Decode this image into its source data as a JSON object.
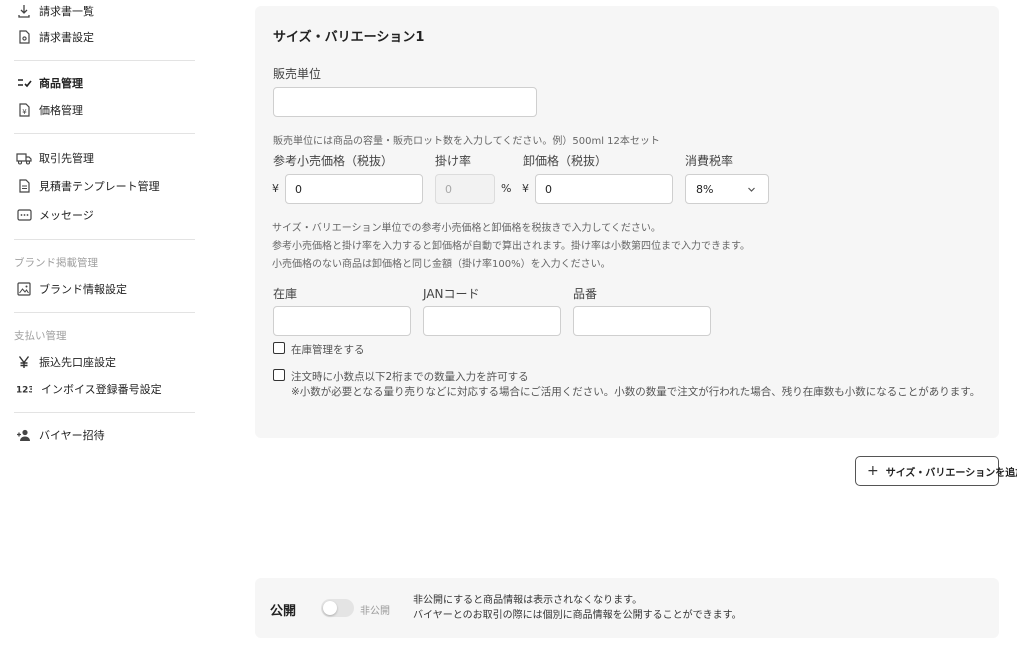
{
  "sidebar": {
    "items": [
      {
        "label": "請求書一覧",
        "icon": "download-icon"
      },
      {
        "label": "請求書設定",
        "icon": "document-gear-icon"
      },
      {
        "label": "商品管理",
        "icon": "list-check-icon"
      },
      {
        "label": "価格管理",
        "icon": "price-document-icon"
      },
      {
        "label": "取引先管理",
        "icon": "truck-icon"
      },
      {
        "label": "見積書テンプレート管理",
        "icon": "document-icon"
      },
      {
        "label": "メッセージ",
        "icon": "message-icon"
      },
      {
        "label": "ブランド情報設定",
        "icon": "image-icon"
      },
      {
        "label": "振込先口座設定",
        "icon": "yen-icon"
      },
      {
        "label": "インボイス登録番号設定",
        "icon": "number-icon"
      },
      {
        "label": "バイヤー招待",
        "icon": "person-add-icon"
      }
    ],
    "sections": {
      "brand": "ブランド掲載管理",
      "payment": "支払い管理"
    }
  },
  "variation": {
    "title": "サイズ・バリエーション1",
    "sales_unit_label": "販売単位",
    "sales_unit_value": "",
    "sales_unit_help": "販売単位には商品の容量・販売ロット数を入力してください。例）500ml 12本セット",
    "retail_price_label": "参考小売価格（税抜）",
    "rate_label": "掛け率",
    "wholesale_label": "卸価格（税抜）",
    "tax_label": "消費税率",
    "yen": "¥",
    "percent": "%",
    "retail_price_value": "0",
    "rate_value": "0",
    "wholesale_value": "0",
    "tax_value": "8%",
    "price_help_1": "サイズ・バリエーション単位での参考小売価格と卸価格を税抜きで入力してください。",
    "price_help_2": "参考小売価格と掛け率を入力すると卸価格が自動で算出されます。掛け率は小数第四位まで入力できます。",
    "price_help_3": "小売価格のない商品は卸価格と同じ金額（掛け率100%）を入力ください。",
    "stock_label": "在庫",
    "jan_label": "JANコード",
    "sku_label": "品番",
    "stock_value": "",
    "jan_value": "",
    "sku_value": "",
    "stock_manage_label": "在庫管理をする",
    "decimal_label": "注文時に小数点以下2桁までの数量入力を許可する",
    "decimal_note": "※小数が必要となる量り売りなどに対応する場合にご活用ください。小数の数量で注文が行われた場合、残り在庫数も小数になることがあります。"
  },
  "add_button_label": "サイズ・バリエーションを追加",
  "publish": {
    "title": "公開",
    "toggle_state": "非公開",
    "desc_1": "非公開にすると商品情報は表示されなくなります。",
    "desc_2": "バイヤーとのお取引の際には個別に商品情報を公開することができます。"
  }
}
